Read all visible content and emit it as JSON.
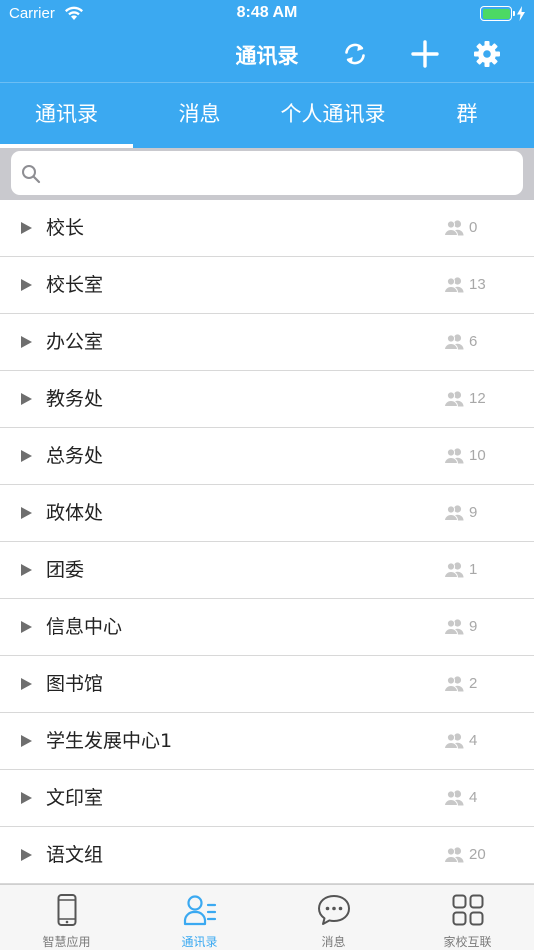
{
  "status_bar": {
    "carrier": "Carrier",
    "time": "8:48 AM"
  },
  "nav": {
    "title": "通讯录",
    "icons": [
      "refresh-icon",
      "plus-icon",
      "gear-icon"
    ]
  },
  "tabs": [
    {
      "label": "通讯录",
      "active": true
    },
    {
      "label": "消息",
      "active": false
    },
    {
      "label": "个人通讯录",
      "active": false
    },
    {
      "label": "群",
      "active": false
    }
  ],
  "search": {
    "placeholder": "",
    "value": ""
  },
  "groups": [
    {
      "name": "校长",
      "count": "0"
    },
    {
      "name": "校长室",
      "count": "13"
    },
    {
      "name": "办公室",
      "count": "6"
    },
    {
      "name": "教务处",
      "count": "12"
    },
    {
      "name": "总务处",
      "count": "10"
    },
    {
      "name": "政体处",
      "count": "9"
    },
    {
      "name": "团委",
      "count": "1"
    },
    {
      "name": "信息中心",
      "count": "9"
    },
    {
      "name": "图书馆",
      "count": "2"
    },
    {
      "name": "学生发展中心1",
      "count": "4"
    },
    {
      "name": "文印室",
      "count": "4"
    },
    {
      "name": "语文组",
      "count": "20"
    }
  ],
  "tabbar": [
    {
      "label": "智慧应用",
      "icon": "phone-icon",
      "active": false
    },
    {
      "label": "通讯录",
      "icon": "contacts-icon",
      "active": true
    },
    {
      "label": "消息",
      "icon": "chat-bubble-icon",
      "active": false
    },
    {
      "label": "家校互联",
      "icon": "grid-icon",
      "active": false
    }
  ],
  "colors": {
    "primary": "#3ba9f1",
    "battery": "#4cd964",
    "count_text": "#a8a8a8"
  }
}
